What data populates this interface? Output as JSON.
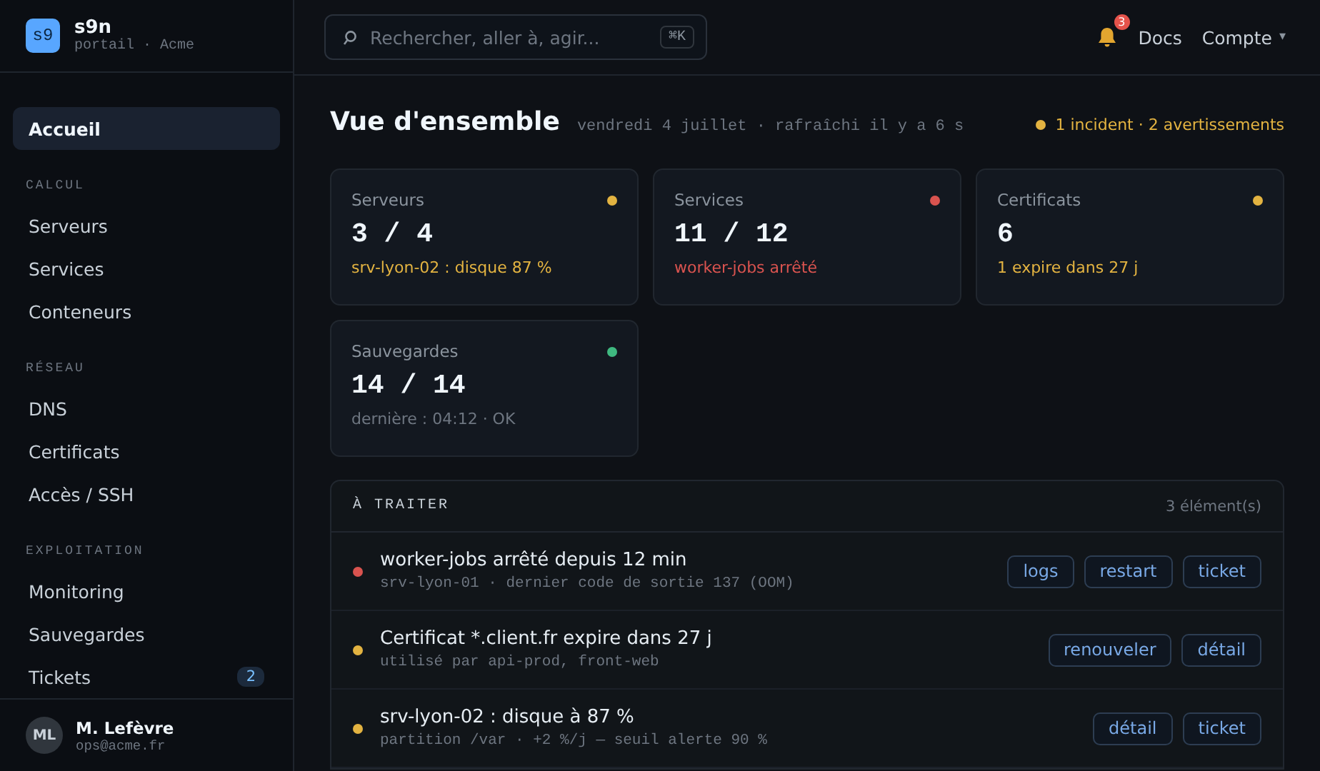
{
  "brand": {
    "logo": "s9",
    "name": "s9n",
    "subtitle": "portail · Acme"
  },
  "sidebar": {
    "items": [
      {
        "label": "Accueil",
        "selected": true
      }
    ],
    "sections": [
      {
        "title": "CALCUL",
        "items": [
          {
            "label": "Serveurs",
            "selected": false
          },
          {
            "label": "Services",
            "selected": false
          },
          {
            "label": "Conteneurs",
            "selected": false
          }
        ]
      },
      {
        "title": "RÉSEAU",
        "items": [
          {
            "label": "DNS",
            "selected": false
          },
          {
            "label": "Certificats",
            "selected": false
          },
          {
            "label": "Accès / SSH",
            "selected": false
          }
        ]
      },
      {
        "title": "EXPLOITATION",
        "items": [
          {
            "label": "Monitoring",
            "selected": false
          },
          {
            "label": "Sauvegardes",
            "selected": false
          },
          {
            "label": "Tickets",
            "selected": false,
            "badge": "2"
          }
        ]
      }
    ]
  },
  "user": {
    "initials": "ML",
    "name": "M. Lefèvre",
    "email": "ops@acme.fr"
  },
  "topbar": {
    "search": {
      "placeholder": "Rechercher, aller à, agir...",
      "shortcut": "⌘K"
    },
    "notifications": "3",
    "links": [
      "Docs"
    ],
    "account": "Compte",
    "account_caret": "▾"
  },
  "overview": {
    "title": "Vue d'ensemble",
    "subtitle": "vendredi 4 juillet · rafraîchi il y a 6 s",
    "alert": "1 incident · 2 avertissements"
  },
  "cards": [
    {
      "label": "Serveurs",
      "value": "3 / 4",
      "note": "srv-lyon-02 : disque 87 %",
      "color": "#e3b341",
      "muted": false
    },
    {
      "label": "Services",
      "value": "11 / 12",
      "note": "worker-jobs arrêté",
      "color": "#d9534f",
      "muted": false
    },
    {
      "label": "Certificats",
      "value": "6",
      "note": "1 expire dans 27 j",
      "color": "#e3b341",
      "muted": false
    },
    {
      "label": "Sauvegardes",
      "value": "14 / 14",
      "note": "dernière : 04:12 · OK",
      "color": "#3fb980",
      "muted": true
    }
  ],
  "todo": {
    "title": "À TRAITER",
    "count": "3 élément(s)",
    "rows": [
      {
        "title": "worker-jobs arrêté depuis 12 min",
        "detail": "srv-lyon-01 · dernier code de sortie 137 (OOM)",
        "color": "#d9534f",
        "actions": [
          "logs",
          "restart",
          "ticket"
        ]
      },
      {
        "title": "Certificat *.client.fr expire dans 27 j",
        "detail": "utilisé par api-prod, front-web",
        "color": "#e3b341",
        "actions": [
          "renouveler",
          "détail"
        ]
      },
      {
        "title": "srv-lyon-02 : disque à 87 %",
        "detail": "partition /var · +2 %/j — seuil alerte 90 %",
        "color": "#e3b341",
        "actions": [
          "détail",
          "ticket"
        ]
      }
    ]
  }
}
